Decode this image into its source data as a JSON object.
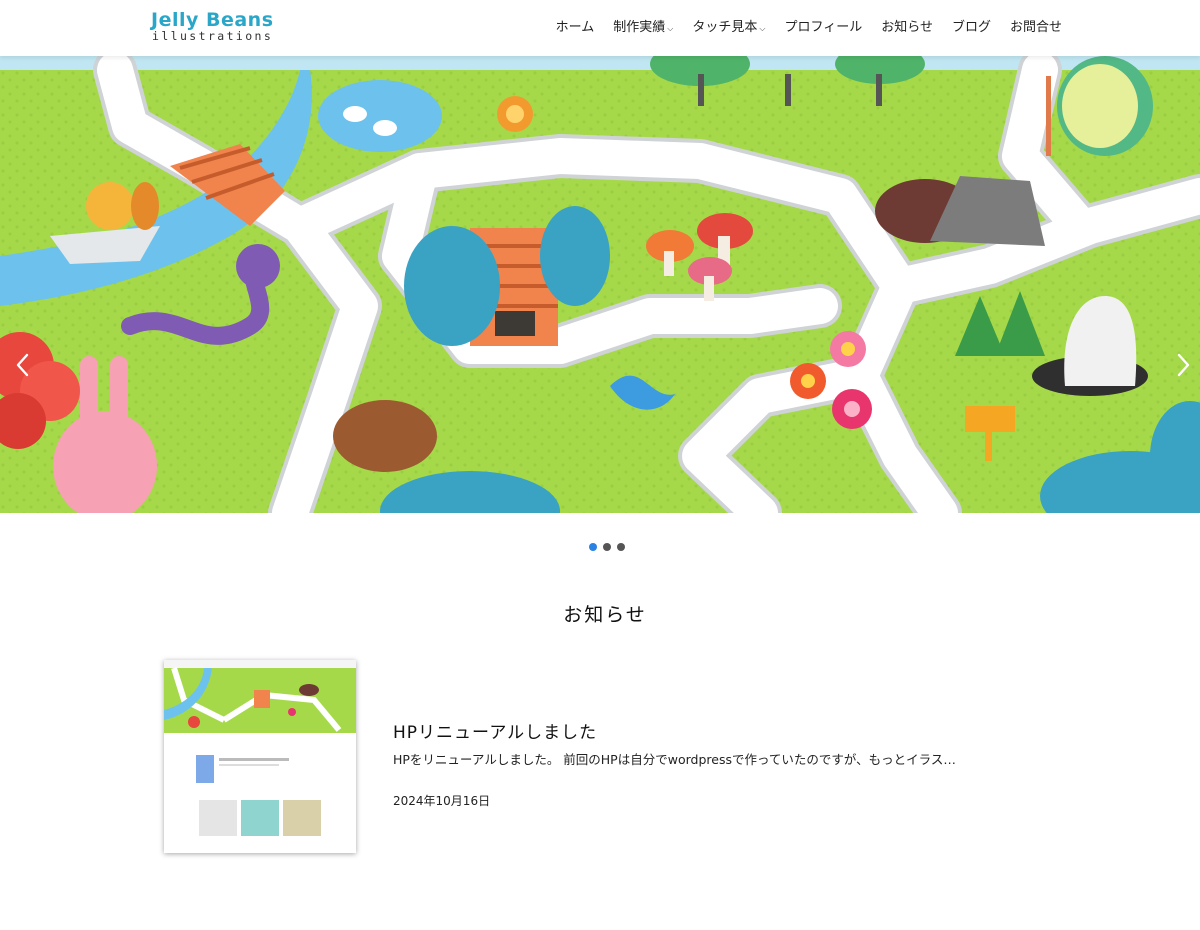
{
  "site": {
    "logo_main": "Jelly Beans",
    "logo_sub": "illustrations"
  },
  "nav": {
    "items": [
      {
        "label": "ホーム",
        "has_dropdown": false
      },
      {
        "label": "制作実績",
        "has_dropdown": true
      },
      {
        "label": "タッチ見本",
        "has_dropdown": true
      },
      {
        "label": "プロフィール",
        "has_dropdown": false
      },
      {
        "label": "お知らせ",
        "has_dropdown": false
      },
      {
        "label": "ブログ",
        "has_dropdown": false
      },
      {
        "label": "お問合せ",
        "has_dropdown": false
      }
    ]
  },
  "slider": {
    "slide_count": 3,
    "active_index": 0,
    "prev_icon": "chevron-left-icon",
    "next_icon": "chevron-right-icon"
  },
  "news": {
    "section_title": "お知らせ",
    "post": {
      "title": "HPリニューアルしました",
      "excerpt": "HPをリニューアルしました。 前回のHPは自分でwordpressで作っていたのですが、もっとイラス…",
      "date": "2024年10月16日"
    }
  },
  "colors": {
    "brand": "#2aa6c9",
    "grass": "#a6d94a",
    "water": "#6cc2ec",
    "path": "#ffffff",
    "dot_active": "#2a83e4",
    "dot_inactive": "#555555"
  }
}
